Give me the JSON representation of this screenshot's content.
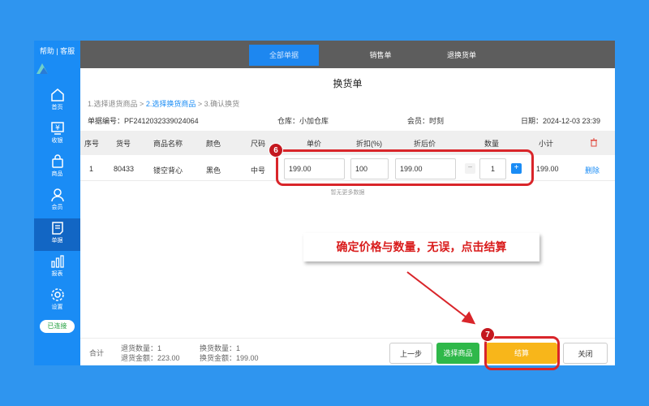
{
  "sidebar": {
    "top_links": "帮助 | 客服",
    "items": [
      {
        "label": "首页",
        "icon": "home-icon"
      },
      {
        "label": "收银",
        "icon": "cashier-icon"
      },
      {
        "label": "商品",
        "icon": "shopping-bag-icon"
      },
      {
        "label": "会员",
        "icon": "user-icon"
      },
      {
        "label": "单据",
        "icon": "receipt-icon"
      },
      {
        "label": "报表",
        "icon": "bar-chart-icon"
      },
      {
        "label": "设置",
        "icon": "gear-icon"
      }
    ],
    "connection_status": "已连接"
  },
  "topbar": {
    "tabs": [
      {
        "label": "全部单据"
      },
      {
        "label": "销售单"
      },
      {
        "label": "退换货单"
      }
    ]
  },
  "page": {
    "title": "换货单",
    "steps": {
      "step1": "1.选择退货商品",
      "sep1": ">",
      "step2": "2.选择换货商品",
      "sep2": ">",
      "step3": "3.确认换货"
    },
    "info": {
      "order_no": "单据编号：PF2412032339024064",
      "warehouse": "仓库：小加仓库",
      "member": "会员：时刻",
      "date": "日期：2024-12-03 23:39"
    }
  },
  "table": {
    "headers": {
      "index": "序号",
      "code": "货号",
      "name": "商品名称",
      "color": "颜色",
      "size": "尺码",
      "price": "单价",
      "discount": "折扣(%)",
      "discounted_price": "折后价",
      "quantity": "数量",
      "subtotal": "小计"
    },
    "rows": [
      {
        "index": "1",
        "code": "80433",
        "name": "镂空背心",
        "color": "黑色",
        "size": "中号",
        "price": "199.00",
        "discount": "100",
        "discounted_price": "199.00",
        "quantity": "1",
        "subtotal": "199.00",
        "delete_label": "删除"
      }
    ],
    "empty_hint": "暂无更多数据"
  },
  "footer": {
    "total_label": "合计",
    "return_qty": "退货数量：1",
    "return_amount": "退货金额：223.00",
    "exchange_qty": "换货数量：1",
    "exchange_amount": "换货金额：199.00",
    "buttons": {
      "prev": "上一步",
      "select_goods": "选择商品",
      "checkout": "结算",
      "close": "关闭"
    }
  },
  "annotations": {
    "badge6": "6",
    "badge7": "7",
    "callout": "确定价格与数量，无误，点击结算"
  },
  "colors": {
    "accent": "#1a8cf5",
    "checkout": "#f8b61a",
    "select": "#2fb84a",
    "highlight": "#d9252a"
  }
}
